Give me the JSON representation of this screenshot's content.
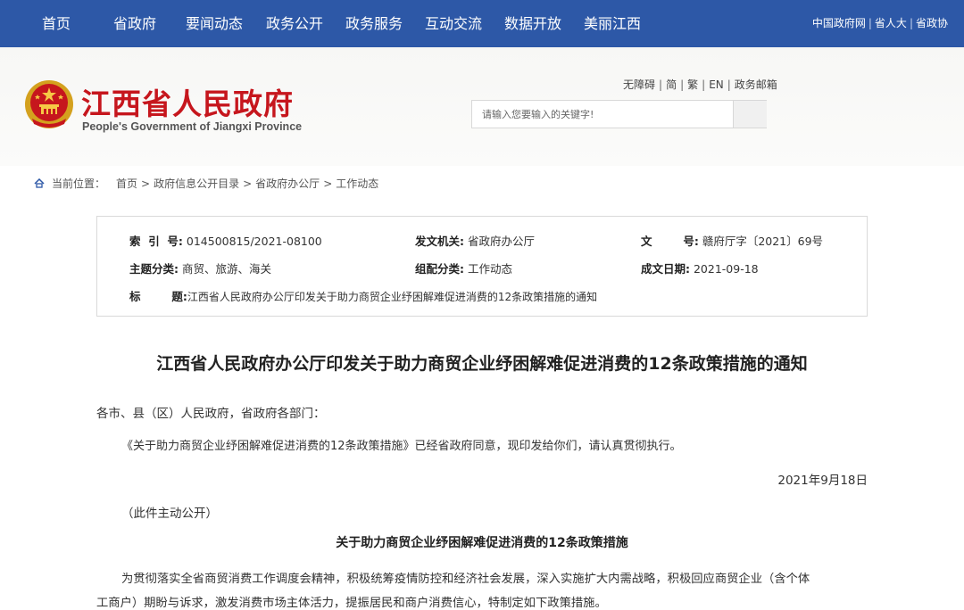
{
  "topnav": {
    "items": [
      "首页",
      "省政府",
      "要闻动态",
      "政务公开",
      "政务服务",
      "互动交流",
      "数据开放",
      "美丽江西"
    ],
    "external_links": [
      "中国政府网",
      "省人大",
      "省政协"
    ],
    "bg_color": "#2d58a7"
  },
  "header": {
    "title": "江西省人民政府",
    "subtitle": "People's Government of Jiangxi Province",
    "util_links": [
      "无障碍",
      "简",
      "繁",
      "EN",
      "政务邮箱"
    ],
    "search": {
      "placeholder": "请输入您要输入的关键字!"
    },
    "title_color": "#c6161d"
  },
  "breadcrumb": {
    "label": "当前位置：",
    "items": [
      "首页",
      "政府信息公开目录",
      "省政府办公厅",
      "工作动态"
    ]
  },
  "meta": {
    "index_no_key": "索  引  号:",
    "index_no": "014500815/2021-08100",
    "issuer_key": "发文机关:",
    "issuer": "省政府办公厅",
    "doc_no_key": "文        号:",
    "doc_no": "赣府厅字〔2021〕69号",
    "topic_key": "主题分类:",
    "topic": "商贸、旅游、海关",
    "category_key": "组配分类:",
    "category": "工作动态",
    "date_key": "成文日期:",
    "date": "2021-09-18",
    "title_key": "标        题:",
    "title": "江西省人民政府办公厅印发关于助力商贸企业纾困解难促进消费的12条政策措施的通知"
  },
  "article": {
    "title": "江西省人民政府办公厅印发关于助力商贸企业纾困解难促进消费的12条政策措施的通知",
    "salutation": "各市、县（区）人民政府，省政府各部门：",
    "body1": "《关于助力商贸企业纾困解难促进消费的12条政策措施》已经省政府同意，现印发给你们，请认真贯彻执行。",
    "date": "2021年9月18日",
    "disclosure": "（此件主动公开）",
    "subtitle": "关于助力商贸企业纾困解难促进消费的12条政策措施",
    "body2_line1": "为贯彻落实全省商贸消费工作调度会精神，积极统筹疫情防控和经济社会发展，深入实施扩大内需战略，积极回应商贸企业（含个体",
    "body2_line2": "工商户）期盼与诉求，激发消费市场主体活力，提振居民和商户消费信心，特制定如下政策措施。"
  }
}
